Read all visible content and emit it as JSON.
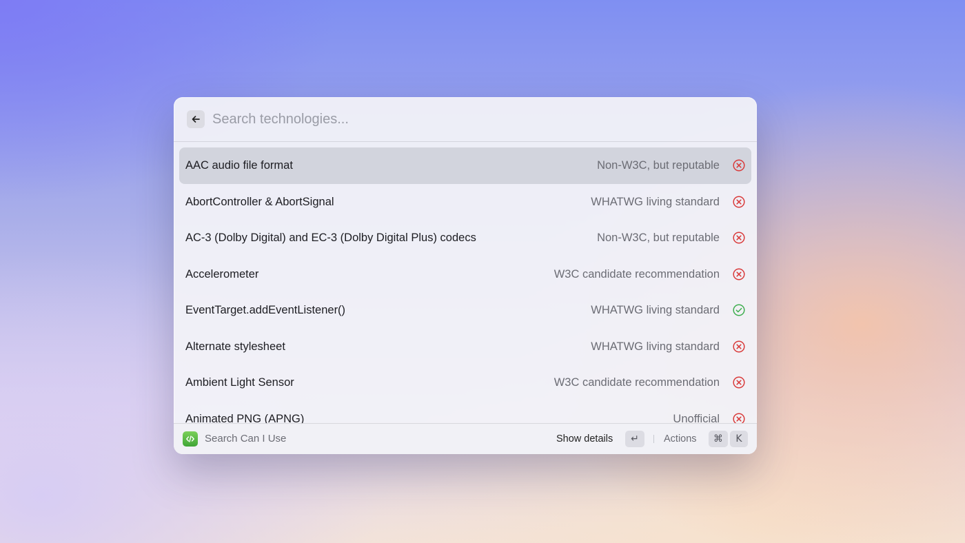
{
  "search": {
    "placeholder": "Search technologies...",
    "back_icon": "arrow-left-icon"
  },
  "items": [
    {
      "title": "AAC audio file format",
      "status": "Non-W3C, but reputable",
      "supported": false,
      "selected": true
    },
    {
      "title": "AbortController & AbortSignal",
      "status": "WHATWG living standard",
      "supported": false,
      "selected": false
    },
    {
      "title": "AC-3 (Dolby Digital) and EC-3 (Dolby Digital Plus) codecs",
      "status": "Non-W3C, but reputable",
      "supported": false,
      "selected": false
    },
    {
      "title": "Accelerometer",
      "status": "W3C candidate recommendation",
      "supported": false,
      "selected": false
    },
    {
      "title": "EventTarget.addEventListener()",
      "status": "WHATWG living standard",
      "supported": true,
      "selected": false
    },
    {
      "title": "Alternate stylesheet",
      "status": "WHATWG living standard",
      "supported": false,
      "selected": false
    },
    {
      "title": "Ambient Light Sensor",
      "status": "W3C candidate recommendation",
      "supported": false,
      "selected": false
    },
    {
      "title": "Animated PNG (APNG)",
      "status": "Unofficial",
      "supported": false,
      "selected": false
    }
  ],
  "footer": {
    "app_name": "Search Can I Use",
    "primary_action": "Show details",
    "primary_key": "↵",
    "actions_label": "Actions",
    "actions_keys": [
      "⌘",
      "K"
    ]
  },
  "colors": {
    "unsupported": "#d93a3a",
    "supported": "#3fae4f",
    "selected_row": "#d2d4dd"
  }
}
